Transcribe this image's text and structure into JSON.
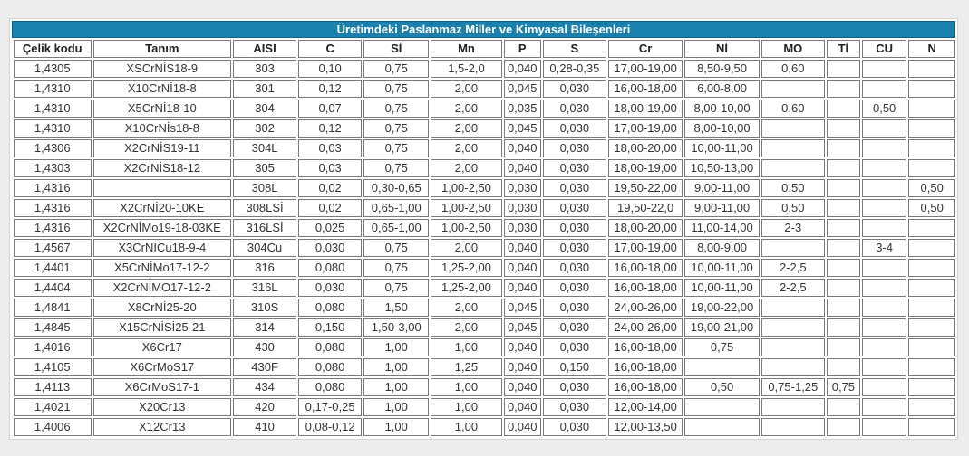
{
  "title": "Üretimdeki Paslanmaz Miller ve Kimyasal Bileşenleri",
  "columns": [
    "Çelik kodu",
    "Tanım",
    "AISI",
    "C",
    "Sİ",
    "Mn",
    "P",
    "S",
    "Cr",
    "Nİ",
    "MO",
    "Tİ",
    "CU",
    "N"
  ],
  "rows": [
    [
      "1,4305",
      "XSCrNİS18-9",
      "303",
      "0,10",
      "0,75",
      "1,5-2,0",
      "0,040",
      "0,28-0,35",
      "17,00-19,00",
      "8,50-9,50",
      "0,60",
      "",
      "",
      ""
    ],
    [
      "1,4310",
      "X10CrNİ18-8",
      "301",
      "0,12",
      "0,75",
      "2,00",
      "0,045",
      "0,030",
      "16,00-18,00",
      "6,00-8,00",
      "",
      "",
      "",
      ""
    ],
    [
      "1,4310",
      "X5CrNİ18-10",
      "304",
      "0,07",
      "0,75",
      "2,00",
      "0,035",
      "0,030",
      "18,00-19,00",
      "8,00-10,00",
      "0,60",
      "",
      "0,50",
      ""
    ],
    [
      "1,4310",
      "X10CrNİs18-8",
      "302",
      "0,12",
      "0,75",
      "2,00",
      "0,045",
      "0,030",
      "17,00-19,00",
      "8,00-10,00",
      "",
      "",
      "",
      ""
    ],
    [
      "1,4306",
      "X2CrNİS19-11",
      "304L",
      "0,03",
      "0,75",
      "2,00",
      "0,040",
      "0,030",
      "18,00-20,00",
      "10,00-11,00",
      "",
      "",
      "",
      ""
    ],
    [
      "1,4303",
      "X2CrNİS18-12",
      "305",
      "0,03",
      "0,75",
      "2,00",
      "0,040",
      "0,030",
      "18,00-19,00",
      "10,50-13,00",
      "",
      "",
      "",
      ""
    ],
    [
      "1,4316",
      "",
      "308L",
      "0,02",
      "0,30-0,65",
      "1,00-2,50",
      "0,030",
      "0,030",
      "19,50-22,00",
      "9,00-11,00",
      "0,50",
      "",
      "",
      "0,50"
    ],
    [
      "1,4316",
      "X2CrNİ20-10KE",
      "308LSİ",
      "0,02",
      "0,65-1,00",
      "1,00-2,50",
      "0,030",
      "0,030",
      "19,50-22,0",
      "9,00-11,00",
      "0,50",
      "",
      "",
      "0,50"
    ],
    [
      "1,4316",
      "X2CrNİMo19-18-03KE",
      "316LSİ",
      "0,025",
      "0,65-1,00",
      "1,00-2,50",
      "0,030",
      "0,030",
      "18,00-20,00",
      "11,00-14,00",
      "2-3",
      "",
      "",
      ""
    ],
    [
      "1,4567",
      "X3CrNİCu18-9-4",
      "304Cu",
      "0,030",
      "0,75",
      "2,00",
      "0,040",
      "0,030",
      "17,00-19,00",
      "8,00-9,00",
      "",
      "",
      "3-4",
      ""
    ],
    [
      "1,4401",
      "X5CrNİMo17-12-2",
      "316",
      "0,080",
      "0,75",
      "1,25-2,00",
      "0,040",
      "0,030",
      "16,00-18,00",
      "10,00-11,00",
      "2-2,5",
      "",
      "",
      ""
    ],
    [
      "1,4404",
      "X2CrNİMO17-12-2",
      "316L",
      "0,030",
      "0,75",
      "1,25-2,00",
      "0,040",
      "0,030",
      "16,00-18,00",
      "10,00-11,00",
      "2-2,5",
      "",
      "",
      ""
    ],
    [
      "1,4841",
      "X8CrNİ25-20",
      "310S",
      "0,080",
      "1,50",
      "2,00",
      "0,045",
      "0,030",
      "24,00-26,00",
      "19,00-22,00",
      "",
      "",
      "",
      ""
    ],
    [
      "1,4845",
      "X15CrNİSİ25-21",
      "314",
      "0,150",
      "1,50-3,00",
      "2,00",
      "0,045",
      "0,030",
      "24,00-26,00",
      "19,00-21,00",
      "",
      "",
      "",
      ""
    ],
    [
      "1,4016",
      "X6Cr17",
      "430",
      "0,080",
      "1,00",
      "1,00",
      "0,040",
      "0,030",
      "16,00-18,00",
      "0,75",
      "",
      "",
      "",
      ""
    ],
    [
      "1,4105",
      "X6CrMoS17",
      "430F",
      "0,080",
      "1,00",
      "1,25",
      "0,040",
      "0,150",
      "16,00-18,00",
      "",
      "",
      "",
      "",
      ""
    ],
    [
      "1,4113",
      "X6CrMoS17-1",
      "434",
      "0,080",
      "1,00",
      "1,00",
      "0,040",
      "0,030",
      "16,00-18,00",
      "0,50",
      "0,75-1,25",
      "0,75",
      "",
      ""
    ],
    [
      "1,4021",
      "X20Cr13",
      "420",
      "0,17-0,25",
      "1,00",
      "1,00",
      "0,040",
      "0,030",
      "12,00-14,00",
      "",
      "",
      "",
      "",
      ""
    ],
    [
      "1,4006",
      "X12Cr13",
      "410",
      "0,08-0,12",
      "1,00",
      "1,00",
      "0,040",
      "0,030",
      "12,00-13,50",
      "",
      "",
      "",
      "",
      ""
    ]
  ]
}
